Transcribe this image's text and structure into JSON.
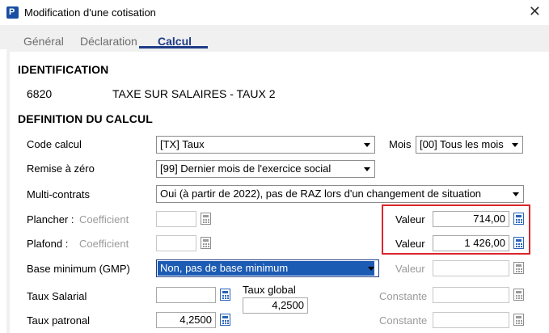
{
  "window": {
    "title": "Modification d'une cotisation",
    "close_glyph": "✕"
  },
  "tabs": [
    {
      "label": "Général"
    },
    {
      "label": "Déclaration"
    },
    {
      "label": "Calcul",
      "active": true
    }
  ],
  "identification": {
    "heading": "IDENTIFICATION",
    "code": "6820",
    "name": "TAXE SUR SALAIRES - TAUX 2"
  },
  "definition": {
    "heading": "DEFINITION DU CALCUL",
    "code_calcul": {
      "label": "Code calcul",
      "value": "[TX]  Taux"
    },
    "mois": {
      "label": "Mois",
      "value": "[00] Tous les mois"
    },
    "remise_zero": {
      "label": "Remise à zéro",
      "value": "[99] Dernier mois de l'exercice social"
    },
    "multi_contrats": {
      "label": "Multi-contrats",
      "value": "Oui (à partir de 2022), pas de RAZ lors d'un changement de situation"
    },
    "plancher": {
      "label": "Plancher :",
      "coef_label": "Coefficient",
      "coef_value": "",
      "valeur_label": "Valeur",
      "valeur": "714,00"
    },
    "plafond": {
      "label": "Plafond :",
      "coef_label": "Coefficient",
      "coef_value": "",
      "valeur_label": "Valeur",
      "valeur": "1 426,00"
    },
    "base_minimum": {
      "label": "Base minimum (GMP)",
      "value": "Non, pas de base minimum",
      "valeur_label": "Valeur",
      "valeur": ""
    },
    "taux_salarial": {
      "label": "Taux Salarial",
      "value": ""
    },
    "taux_global": {
      "label": "Taux global",
      "value": "4,2500"
    },
    "taux_patronal": {
      "label": "Taux patronal",
      "value": "4,2500"
    },
    "constante_1": {
      "label": "Constante",
      "value": ""
    },
    "constante_2": {
      "label": "Constante",
      "value": ""
    }
  },
  "icons": {
    "calculator": "calculator-icon",
    "app": "app-icon"
  },
  "colors": {
    "accent": "#1f3c88",
    "highlight_box": "#d9262c",
    "selection": "#1c5bb3"
  }
}
